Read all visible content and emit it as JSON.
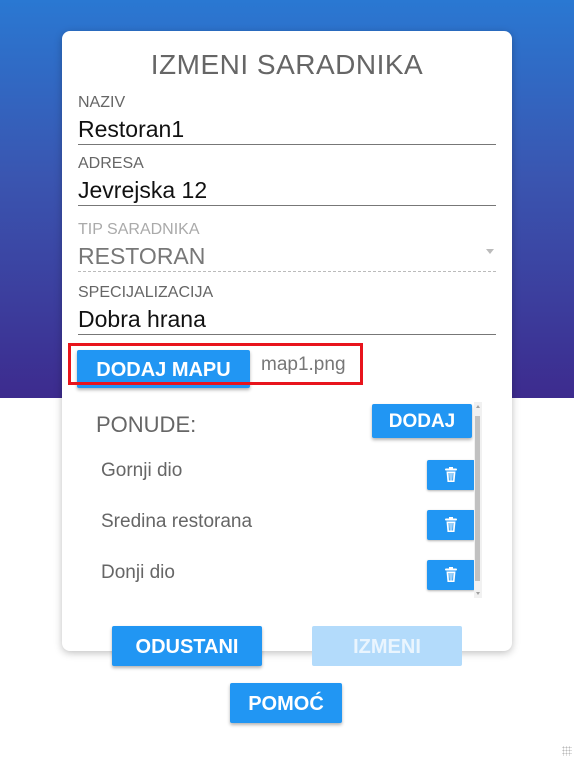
{
  "dialog": {
    "title": "IZMENI SARADNIKA",
    "fields": {
      "naziv": {
        "label": "NAZIV",
        "value": "Restoran1"
      },
      "adresa": {
        "label": "ADRESA",
        "value": "Jevrejska 12"
      },
      "tip": {
        "label": "TIP SARADNIKA",
        "value": "RESTORAN"
      },
      "specijalizacija": {
        "label": "SPECIJALIZACIJA",
        "value": "Dobra hrana"
      }
    },
    "add_map_label": "DODAJ MAPU",
    "map_file": "map1.png",
    "offers": {
      "title": "PONUDE:",
      "add_label": "DODAJ",
      "items": [
        {
          "label": "Gornji dio"
        },
        {
          "label": "Sredina restorana"
        },
        {
          "label": "Donji dio"
        }
      ]
    },
    "cancel_label": "ODUSTANI",
    "submit_label": "IZMENI",
    "help_label": "POMOĆ"
  },
  "colors": {
    "accent": "#2196f3",
    "highlight": "#e8141c",
    "gradient_top": "#2a78d2",
    "gradient_bottom": "#3d2b8e"
  },
  "icons": {
    "delete": "trash-icon",
    "select": "chevron-down-icon"
  }
}
